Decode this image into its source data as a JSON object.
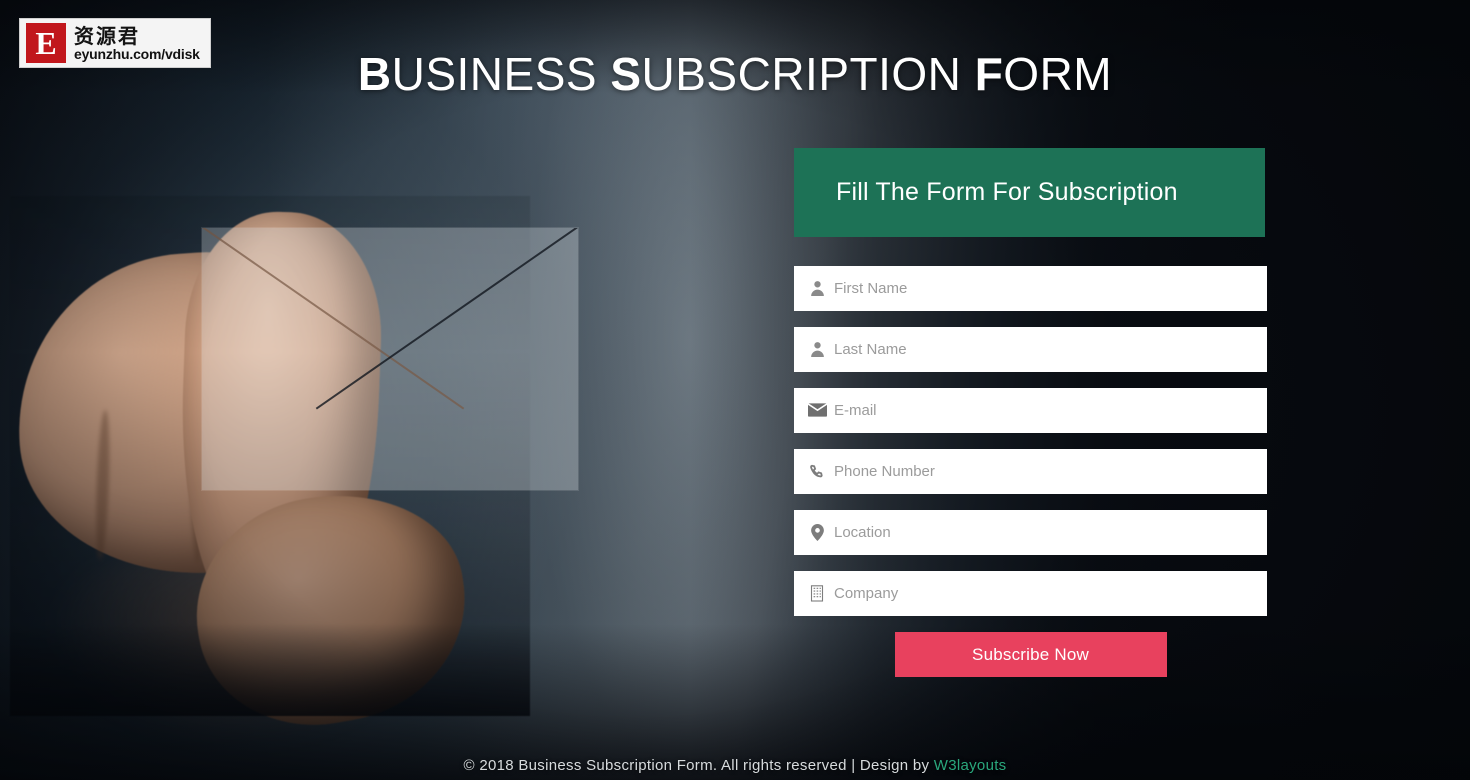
{
  "watermark": {
    "logo_letter": "E",
    "brand_cn": "资源君",
    "url": "eyunzhu.com/vdisk"
  },
  "header": {
    "title_part1_cap": "B",
    "title_part1": "USINESS ",
    "title_part2_cap": "S",
    "title_part2": "UBSCRIPTION ",
    "title_part3_cap": "F",
    "title_part3": "ORM",
    "title_full": "BUSINESS SUBSCRIPTION FORM"
  },
  "form": {
    "banner_title": "Fill The Form For Subscription",
    "banner_color": "#1d7256",
    "fields": [
      {
        "name": "first-name",
        "icon": "user-icon",
        "placeholder": "First Name",
        "value": ""
      },
      {
        "name": "last-name",
        "icon": "user-icon",
        "placeholder": "Last Name",
        "value": ""
      },
      {
        "name": "email",
        "icon": "envelope-icon",
        "placeholder": "E-mail",
        "value": ""
      },
      {
        "name": "phone",
        "icon": "phone-icon",
        "placeholder": "Phone Number",
        "value": ""
      },
      {
        "name": "location",
        "icon": "map-pin-icon",
        "placeholder": "Location",
        "value": ""
      },
      {
        "name": "company",
        "icon": "building-icon",
        "placeholder": "Company",
        "value": ""
      }
    ],
    "submit_label": "Subscribe Now",
    "submit_color": "#e8415e"
  },
  "footer": {
    "text": "© 2018 Business Subscription Form. All rights reserved | Design by ",
    "link_label": "W3layouts",
    "link_color": "#2aa87d"
  },
  "background": {
    "description": "pointing-hand-photo",
    "envelope_icon": "envelope-overlay-icon"
  }
}
